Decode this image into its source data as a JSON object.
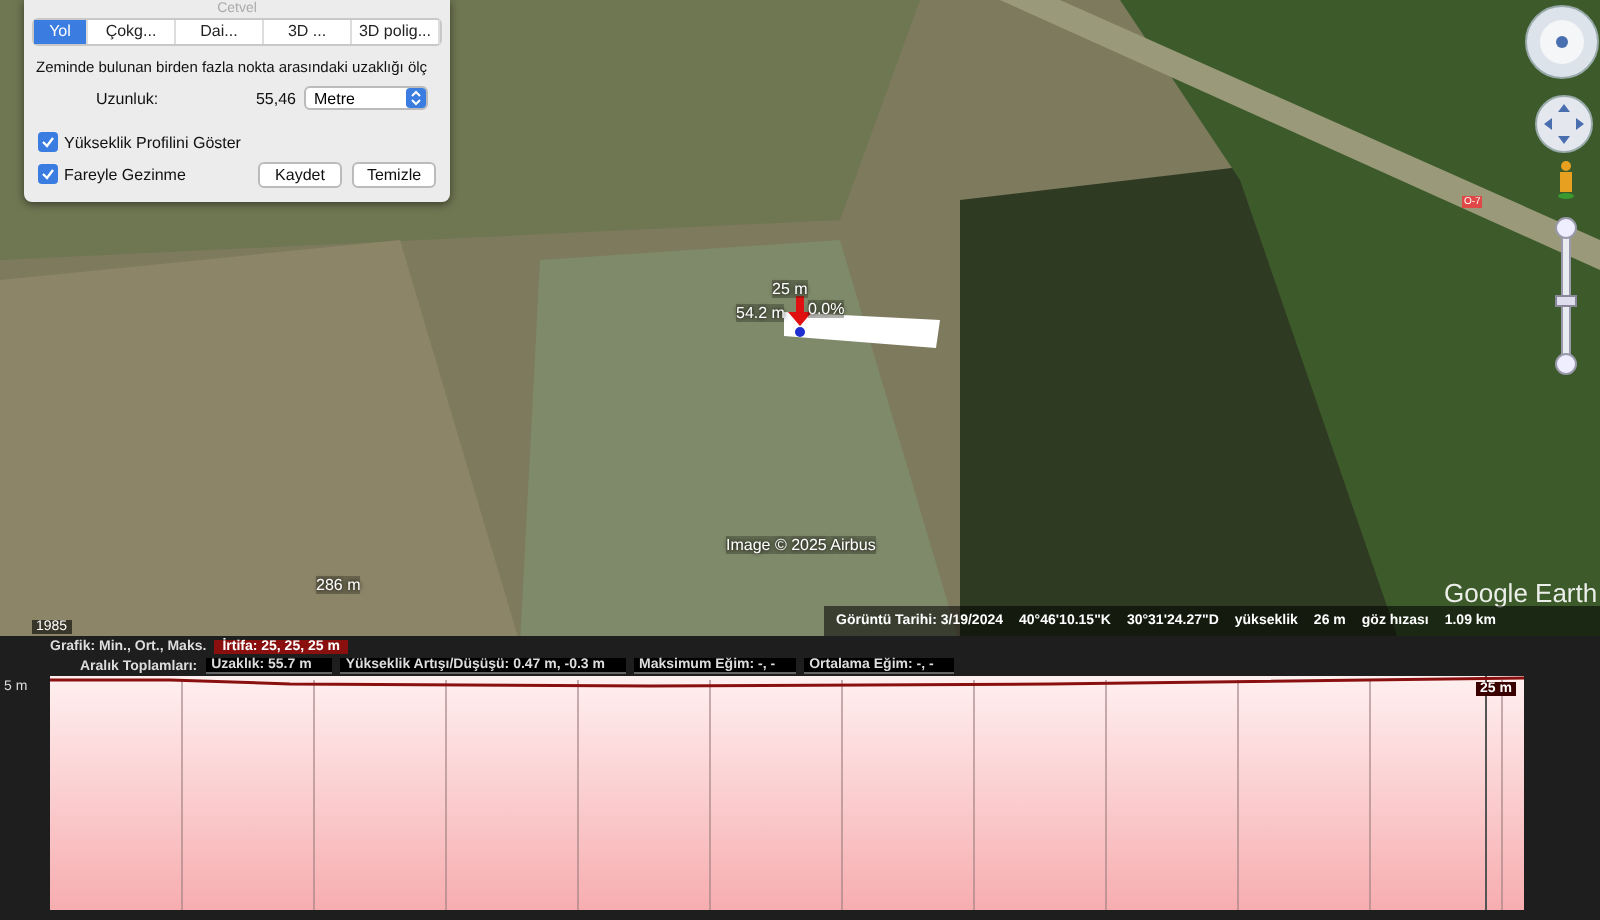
{
  "ruler_dialog": {
    "title": "Cetvel",
    "tabs": [
      {
        "label": "Yol",
        "selected": true
      },
      {
        "label": "Çokg...",
        "selected": false
      },
      {
        "label": "Dai...",
        "selected": false
      },
      {
        "label": "3D ...",
        "selected": false
      },
      {
        "label": "3D polig...",
        "selected": false
      }
    ],
    "description": "Zeminde bulunan birden fazla nokta arasındaki uzaklığı ölç",
    "length": {
      "label": "Uzunluk:",
      "value": "55,46",
      "unit": "Metre"
    },
    "options": [
      {
        "label": "Yükseklik Profilini Göster",
        "checked": true
      },
      {
        "label": "Fareyle Gezinme",
        "checked": true
      }
    ],
    "buttons": [
      "Kaydet",
      "Temizle"
    ]
  },
  "map": {
    "zoom_slider": {
      "level": 0.5
    },
    "measurement": {
      "height": "25 m",
      "distance": "54.2 m",
      "slope": "0.0%"
    },
    "road_sign": "O-7",
    "scale_label": "286 m",
    "copyright": "Image © 2025 Airbus",
    "brand": "Google Earth",
    "year": "1985"
  },
  "status_bar": {
    "date": "Görüntü Tarihi: 3/19/2024",
    "latitude": "40°46'10.15\"K",
    "longitude": "30°31'24.27\"D",
    "elevation_label": "yükseklik",
    "elevation": "26 m",
    "eye_label": "göz hızası",
    "eye": "1.09 km"
  },
  "elevation_profile": {
    "graph_label": "Grafik: Min., Ort., Maks.",
    "altitude": "İrtifa: 25, 25, 25 m",
    "totals_label": "Aralık Toplamları:",
    "totals": [
      "Uzaklık: 55.7 m",
      "Yükseklik Artışı/Düşüşü: 0.47 m, -0.3 m",
      "Maksimum Eğim: -, -",
      "Ortalama Eğim: -, -"
    ],
    "axis_label": "5 m",
    "cursor_label": "25 m"
  }
}
